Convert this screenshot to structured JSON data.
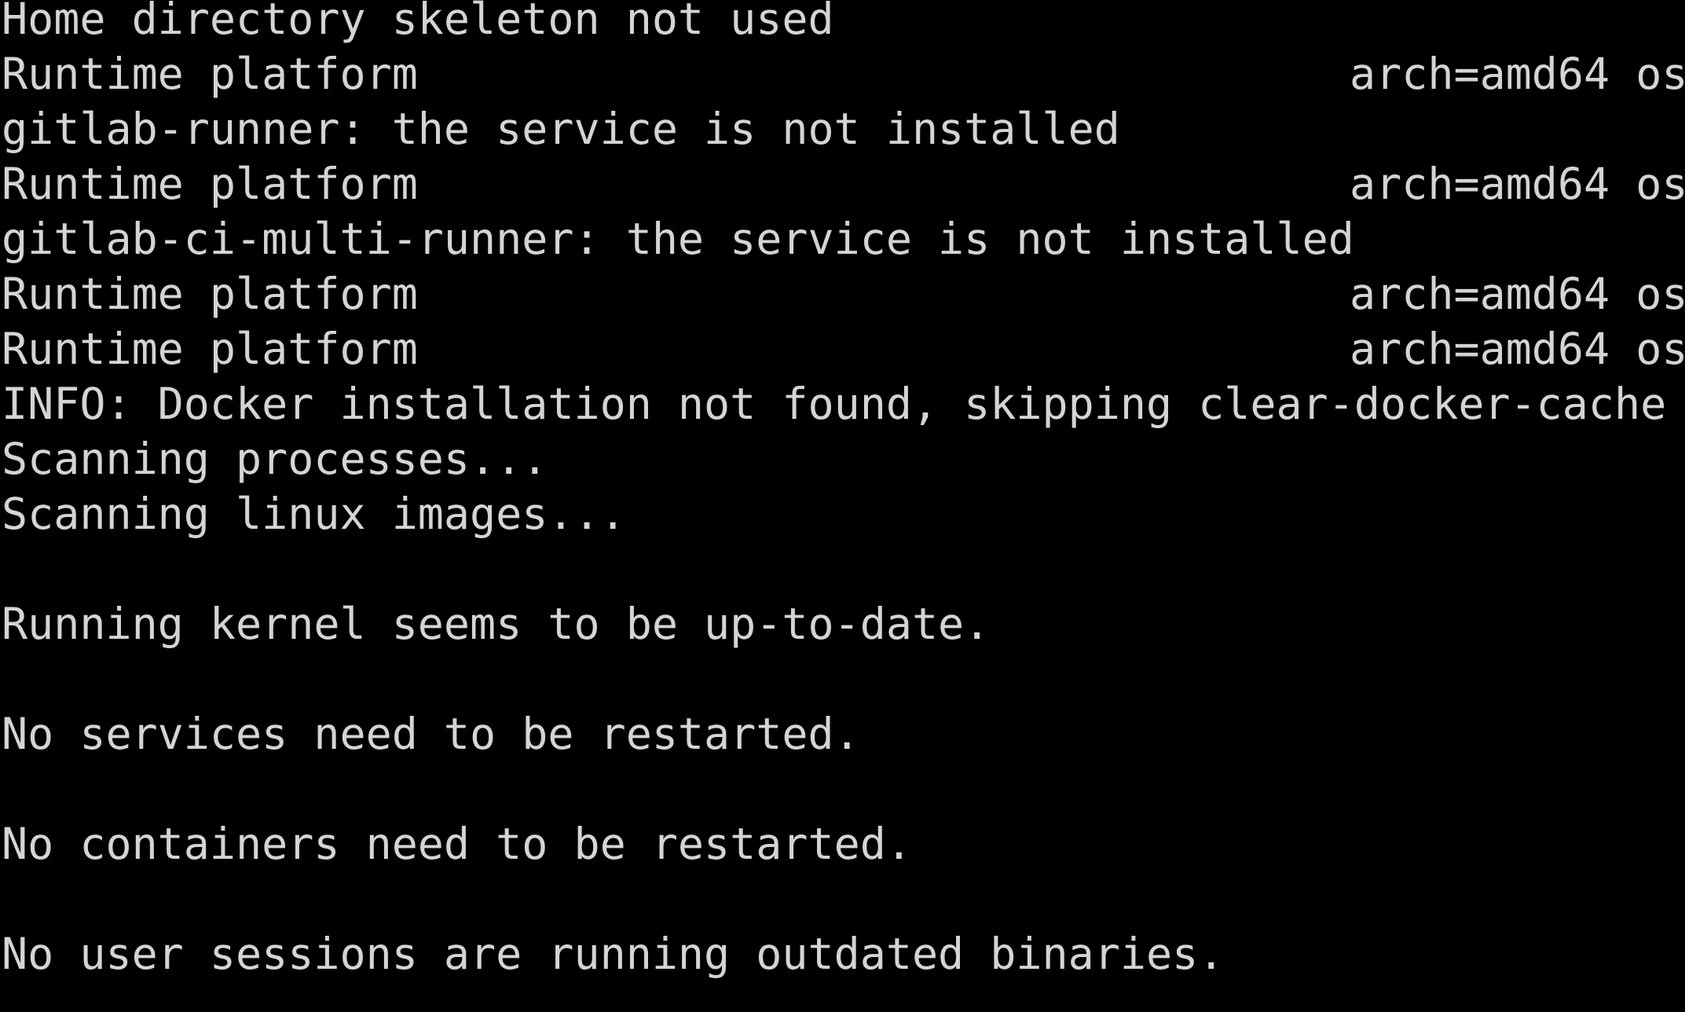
{
  "terminal": {
    "background": "#000000",
    "foreground": "#d4d4d4",
    "lines": [
      {
        "text": "Home directory skeleton not used",
        "right": ""
      },
      {
        "text": "Runtime platform",
        "right": "arch=amd64 os"
      },
      {
        "text": "gitlab-runner: the service is not installed",
        "right": ""
      },
      {
        "text": "Runtime platform",
        "right": "arch=amd64 os"
      },
      {
        "text": "gitlab-ci-multi-runner: the service is not installed",
        "right": ""
      },
      {
        "text": "Runtime platform",
        "right": "arch=amd64 os"
      },
      {
        "text": "Runtime platform",
        "right": "arch=amd64 os"
      },
      {
        "text": "INFO: Docker installation not found, skipping clear-docker-cache",
        "right": ""
      },
      {
        "text": "Scanning processes...",
        "right": ""
      },
      {
        "text": "Scanning linux images...",
        "right": ""
      },
      {
        "text": "",
        "right": ""
      },
      {
        "text": "Running kernel seems to be up-to-date.",
        "right": ""
      },
      {
        "text": "",
        "right": ""
      },
      {
        "text": "No services need to be restarted.",
        "right": ""
      },
      {
        "text": "",
        "right": ""
      },
      {
        "text": "No containers need to be restarted.",
        "right": ""
      },
      {
        "text": "",
        "right": ""
      },
      {
        "text": "No user sessions are running outdated binaries.",
        "right": ""
      }
    ]
  }
}
